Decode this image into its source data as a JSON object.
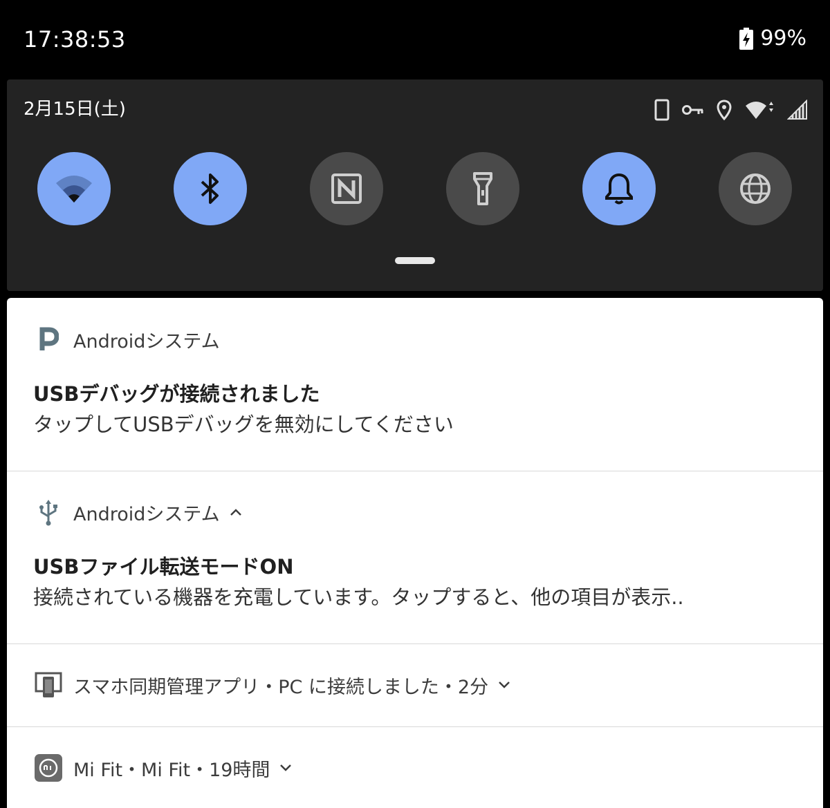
{
  "status_bar": {
    "time": "17:38:53",
    "battery": "99%"
  },
  "quick_settings": {
    "date": "2月15日(土)",
    "tiles": [
      {
        "name": "wifi",
        "icon": "wifi-icon",
        "state": "on"
      },
      {
        "name": "bluetooth",
        "icon": "bluetooth-icon",
        "state": "on"
      },
      {
        "name": "nfc",
        "icon": "nfc-icon",
        "state": "off"
      },
      {
        "name": "flashlight",
        "icon": "flashlight-icon",
        "state": "off"
      },
      {
        "name": "notifications",
        "icon": "bell-icon",
        "state": "on"
      },
      {
        "name": "vpn",
        "icon": "globe-icon",
        "state": "off"
      }
    ],
    "status_icons": [
      "phone-icon",
      "key-icon",
      "location-icon",
      "wifi-signal-icon",
      "cell-signal-icon"
    ]
  },
  "notifications": [
    {
      "app": "Androidシステム",
      "title": "USBデバッグが接続されました",
      "text": "タップしてUSBデバッグを無効にしてください"
    },
    {
      "app": "Androidシステム",
      "title": "USBファイル転送モードON",
      "text": "接続されている機器を充電しています。タップすると、他の項目が表示.."
    },
    {
      "summary": "スマホ同期管理アプリ・PC に接続しました・2分"
    },
    {
      "summary": "Mi Fit・Mi Fit・19時間"
    }
  ],
  "colors": {
    "tile_on": "#80a8f6",
    "tile_off": "#4a4a4a",
    "shade": "#232323",
    "app_icon": "#5e7580"
  }
}
